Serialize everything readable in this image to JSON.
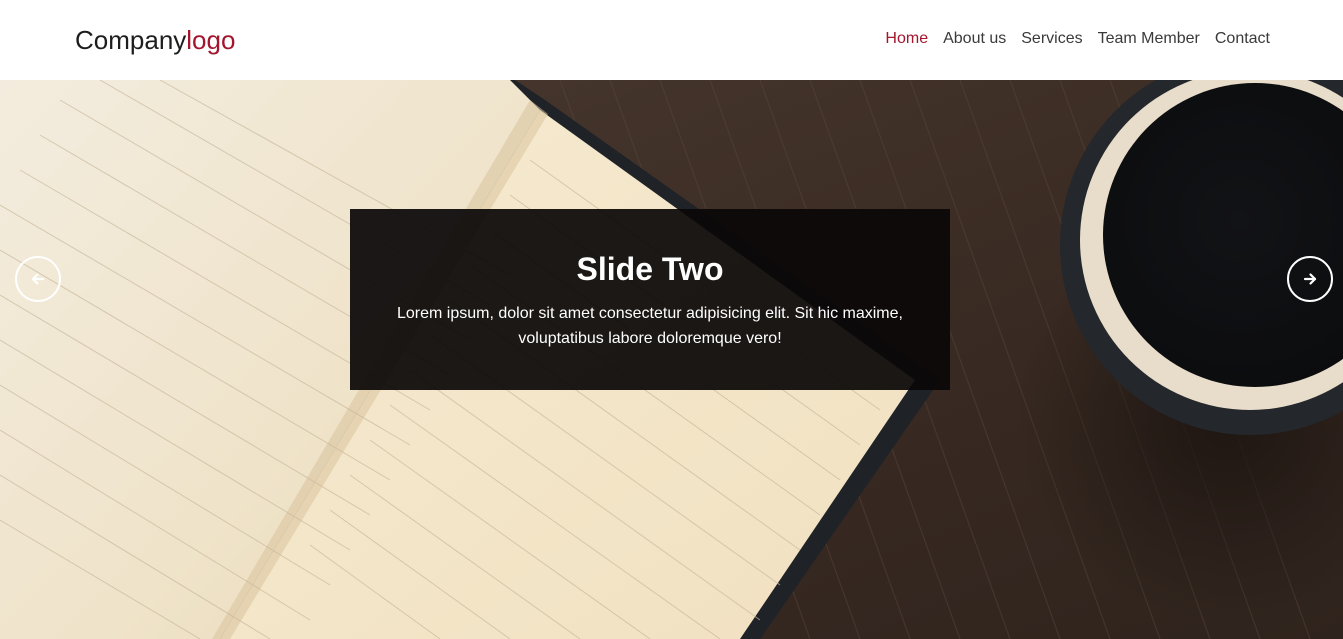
{
  "header": {
    "logo_main": "Company",
    "logo_accent": "logo",
    "nav": [
      {
        "label": "Home",
        "active": true
      },
      {
        "label": "About us",
        "active": false
      },
      {
        "label": "Services",
        "active": false
      },
      {
        "label": "Team Member",
        "active": false
      },
      {
        "label": "Contact",
        "active": false
      }
    ]
  },
  "carousel": {
    "slide_title": "Slide Two",
    "slide_text": "Lorem ipsum, dolor sit amet consectetur adipisicing elit. Sit hic maxime, voluptatibus labore doloremque vero!",
    "prev_icon": "arrow-left-icon",
    "next_icon": "arrow-right-icon",
    "background_image": "open-notebook-and-coffee-cup-on-wooden-table"
  },
  "colors": {
    "accent": "#a3162d",
    "nav_text": "#3a3a3a",
    "caption_bg": "#0a0808",
    "hero_wood": "#3e2e25"
  }
}
